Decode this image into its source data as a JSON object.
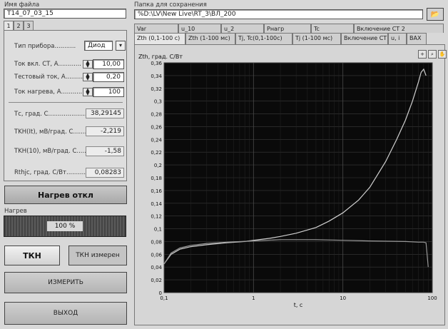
{
  "left": {
    "file_label": "Имя файла",
    "file_value": "T14_07_03_15",
    "tabs": [
      "1",
      "2",
      "3"
    ],
    "device_type_label": "Тип прибора...........",
    "device_type_value": "Диод",
    "params": [
      {
        "label": "Ток вкл. СТ, А............",
        "value": "10,00"
      },
      {
        "label": "Тестовый ток, А............",
        "value": "0,20"
      },
      {
        "label": "Ток нагрева, А..............",
        "value": "100"
      }
    ],
    "readouts": [
      {
        "label": "Тс, град. С...........................",
        "value": "38,29145"
      },
      {
        "label": "TKH(It), мВ/град. С.............",
        "value": "-2,219"
      },
      {
        "label": "TKH(10), мВ/град. С.........",
        "value": "-1,58"
      },
      {
        "label": "Rthjc, град. С/Вт..............",
        "value": "0,08283"
      }
    ],
    "heat_button": "Нагрев откл",
    "heat_label": "Нагрев",
    "heat_progress_text": "100 %",
    "heat_progress": 1.0,
    "tkn_button": "ТКН",
    "tkn_measured_button": "ТКН измерен",
    "measure_button": "ИЗМЕРИТЬ",
    "exit_button": "ВЫХОД"
  },
  "right": {
    "folder_label": "Папка для сохранения",
    "folder_value": "%D:\\LV\\New Live\\RT_3\\ВЛ_200",
    "tabs_row1": [
      "Var",
      "u_10",
      "u_2",
      "Рнагр",
      "Tc",
      "Включение СТ 2"
    ],
    "tabs_row2": [
      "Zth (0,1-100 с)",
      "Zth (1-100 мс)",
      "Tj, Tc(0,1-100c)",
      "Tj (1-100 мс)",
      "Включение СТ",
      "u, i",
      "ВАХ"
    ]
  },
  "chart_data": {
    "type": "line",
    "ylabel": "Zth, град. С/Вт",
    "xlabel": "t, c",
    "x_scale": "log",
    "xlim": [
      0.1,
      100
    ],
    "ylim": [
      0,
      0.36
    ],
    "x_ticks": [
      "0,1",
      "1",
      "10",
      "100"
    ],
    "y_ticks": [
      "0",
      "0,02",
      "0,04",
      "0,06",
      "0,08",
      "0,1",
      "0,12",
      "0,14",
      "0,16",
      "0,18",
      "0,2",
      "0,22",
      "0,24",
      "0,26",
      "0,28",
      "0,3",
      "0,32",
      "0,34",
      "0,36"
    ],
    "grid": true,
    "background": "#0a0a0a",
    "series": [
      {
        "color": "#d0d0d0",
        "x": [
          0.1,
          0.12,
          0.15,
          0.2,
          0.3,
          0.5,
          0.8,
          1,
          1.5,
          2,
          3,
          5,
          7,
          10,
          15,
          20,
          30,
          40,
          50,
          60,
          70,
          75,
          80,
          85
        ],
        "y": [
          0.045,
          0.06,
          0.068,
          0.072,
          0.075,
          0.078,
          0.08,
          0.082,
          0.085,
          0.088,
          0.093,
          0.102,
          0.112,
          0.125,
          0.145,
          0.165,
          0.205,
          0.24,
          0.27,
          0.3,
          0.33,
          0.345,
          0.35,
          0.34
        ]
      },
      {
        "color": "#9a9a9a",
        "x": [
          0.1,
          0.12,
          0.15,
          0.2,
          0.3,
          0.5,
          1,
          2,
          5,
          10,
          20,
          50,
          70,
          80,
          85,
          90
        ],
        "y": [
          0.045,
          0.062,
          0.07,
          0.074,
          0.077,
          0.079,
          0.081,
          0.083,
          0.083,
          0.082,
          0.081,
          0.08,
          0.079,
          0.079,
          0.078,
          0.04
        ]
      }
    ]
  }
}
